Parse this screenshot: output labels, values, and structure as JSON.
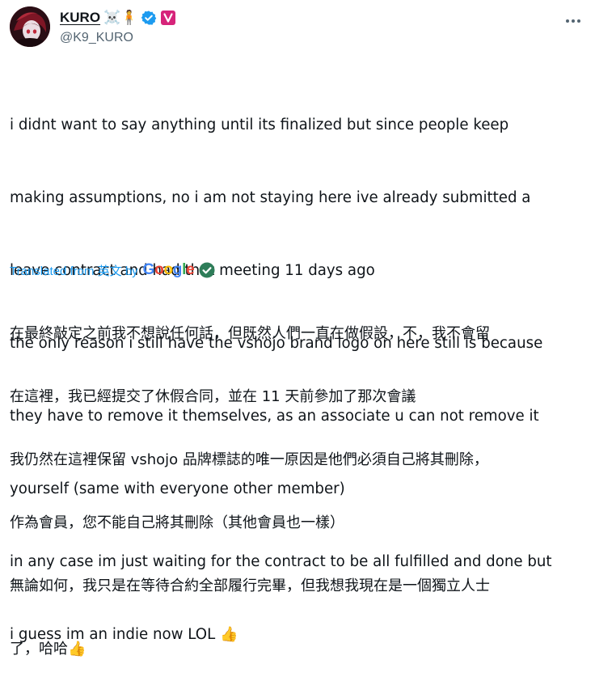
{
  "author": {
    "display_name": "KURO",
    "name_emojis": "☠️🧍",
    "handle": "@K9_KURO"
  },
  "post": {
    "lines": [
      "i didnt want to say anything until its finalized but since people keep",
      "making assumptions, no i am not staying here ive already submitted a",
      "leave contract and had that meeting 11 days ago",
      "the only reason i still have the vshojo brand logo on here still is because",
      "they have to remove it themselves, as an associate u can not remove it",
      "yourself (same with everyone other member)",
      "in any case im just waiting for the contract to be all fulfilled and done but",
      "i guess im an indie now LOL"
    ],
    "end_emoji": "👍"
  },
  "translation": {
    "label": "Translated from 英文 by",
    "provider": "Google",
    "lines": [
      "在最終敲定之前我不想說任何話，但既然人們一直在做假設，不，我不會留",
      "在這裡，我已經提交了休假合同，並在 11 天前參加了那次會議",
      "我仍然在這裡保留 vshojo 品牌標誌的唯一原因是他們必須自己將其刪除，",
      "作為會員，您不能自己將其刪除（其他會員也一樣）",
      "無論如何，我只是在等待合約全部履行完畢，但我想我現在是一個獨立人士",
      "了，哈哈"
    ],
    "end_emoji": "👍"
  },
  "colors": {
    "text": "#0f1419",
    "secondary": "#536471",
    "link": "#1d9bf0",
    "verified": "#1d9bf0",
    "affiliate_badge": "#d6247a"
  }
}
